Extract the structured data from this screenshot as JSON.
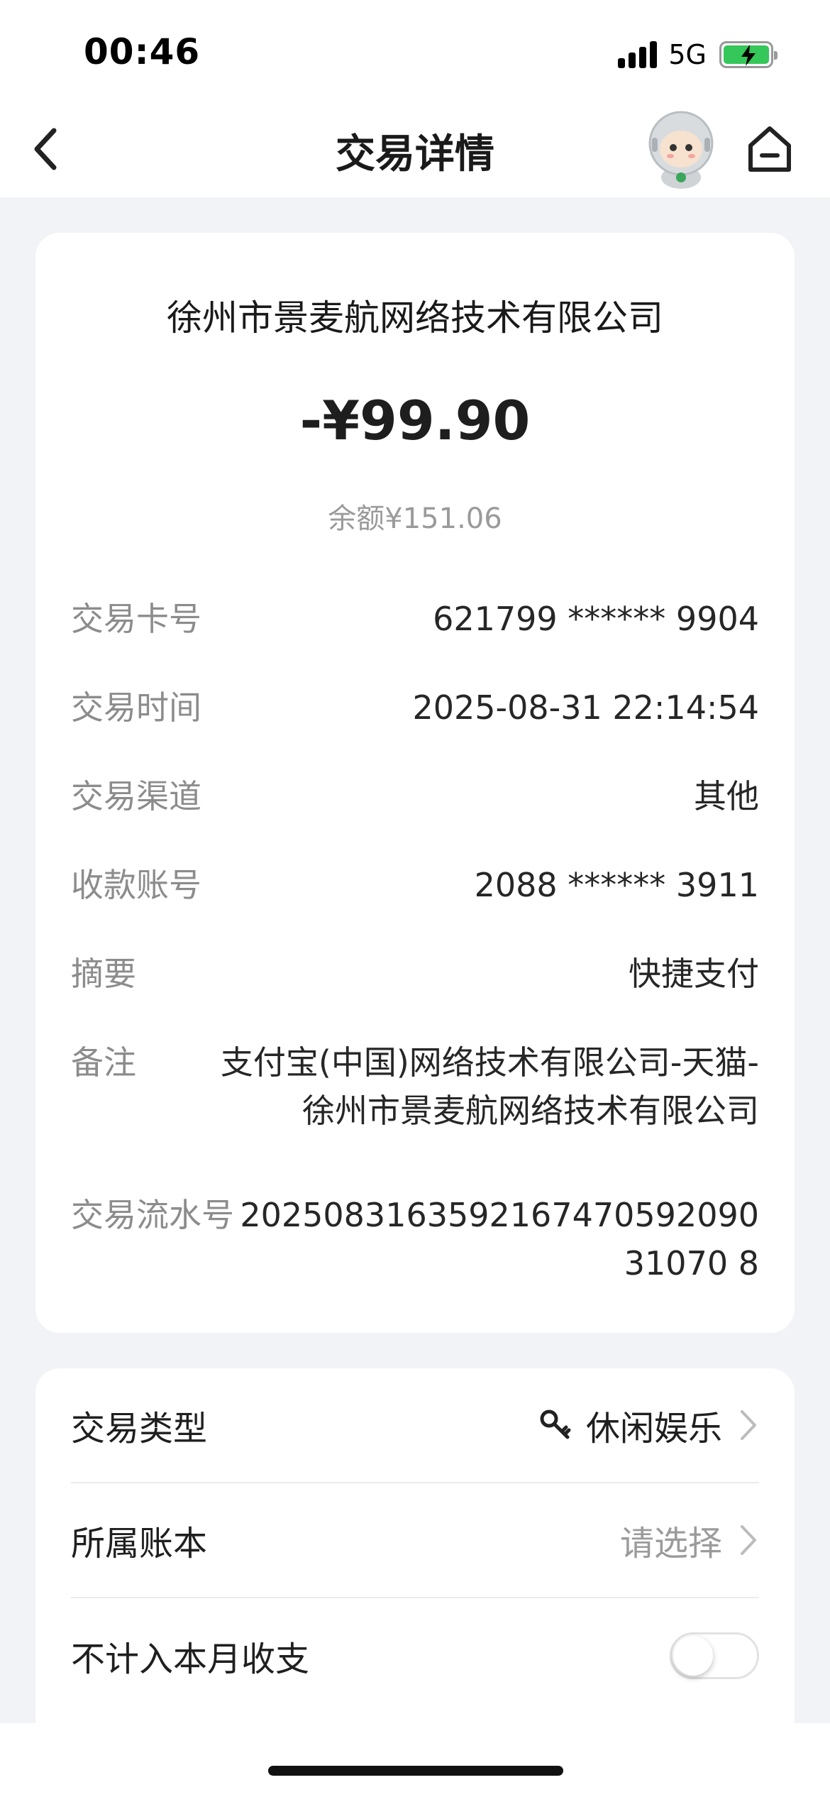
{
  "status_bar": {
    "time": "00:46",
    "network": "5G",
    "battery": 0.8
  },
  "nav": {
    "title": "交易详情"
  },
  "transaction": {
    "merchant": "徐州市景麦航网络技术有限公司",
    "amount": "-¥99.90",
    "balance": "余额¥151.06",
    "rows": [
      {
        "label": "交易卡号",
        "value": "621799 ****** 9904"
      },
      {
        "label": "交易时间",
        "value": "2025-08-31 22:14:54"
      },
      {
        "label": "交易渠道",
        "value": "其他"
      },
      {
        "label": "收款账号",
        "value": "2088 ****** 3911"
      },
      {
        "label": "摘要",
        "value": "快捷支付"
      },
      {
        "label": "备注",
        "value": "支付宝(中国)网络技术有限公司-天猫-徐州市景麦航网络技术有限公司"
      },
      {
        "label": "交易流水号",
        "value": "202508316359216747059209031070 8"
      }
    ]
  },
  "details": {
    "type_label": "交易类型",
    "type_value": "休闲娱乐",
    "book_label": "所属账本",
    "book_value": "请选择",
    "exclude_label": "不计入本月收支",
    "exclude_on": false
  }
}
